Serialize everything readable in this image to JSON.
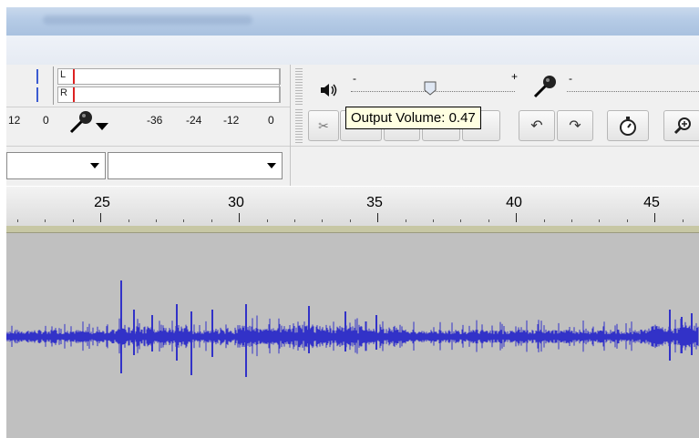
{
  "window": {
    "title": ""
  },
  "meter": {
    "left_channel": "L",
    "right_channel": "R",
    "scale": [
      "12",
      "0",
      "-36",
      "-24",
      "-12",
      "0"
    ]
  },
  "playback": {
    "min_sign": "-",
    "max_sign": "+",
    "volume": 0.47
  },
  "recording": {
    "min_sign": "-"
  },
  "tooltip": {
    "text": "Output Volume: 0.47"
  },
  "icons": {
    "speaker": "speaker-icon",
    "microphone": "microphone-icon",
    "cut": "scissors-icon",
    "undo": "undo-icon",
    "redo": "redo-icon",
    "timer": "timer-icon",
    "zoom": "zoom-in-icon",
    "dropdown": "chevron-down-icon"
  },
  "ruler": {
    "labels": [
      "25",
      "30",
      "35",
      "40",
      "45"
    ]
  },
  "colors": {
    "waveform": "#3232c8",
    "track_bg": "#c0c0c0",
    "tooltip_bg": "#ffffe1"
  }
}
